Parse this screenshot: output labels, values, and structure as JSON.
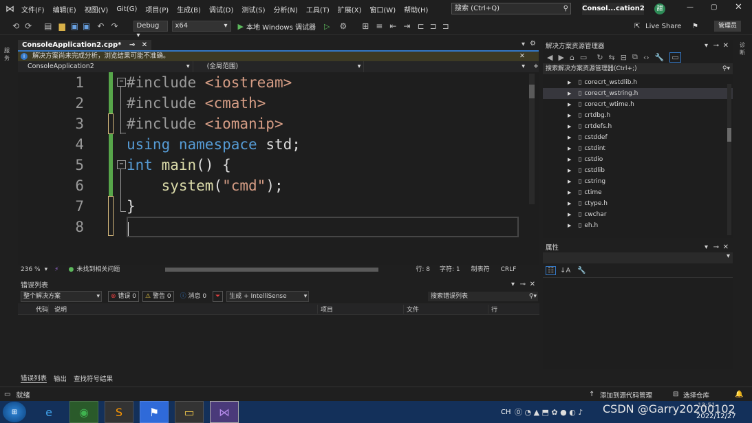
{
  "menu": [
    "文件(F)",
    "编辑(E)",
    "视图(V)",
    "Git(G)",
    "项目(P)",
    "生成(B)",
    "调试(D)",
    "测试(S)",
    "分析(N)",
    "工具(T)",
    "扩展(X)",
    "窗口(W)",
    "帮助(H)"
  ],
  "search": {
    "placeholder": "搜索 (Ctrl+Q)"
  },
  "solution_name": "Consol...cation2",
  "user_initial": "甜",
  "toolbar": {
    "config": "Debug",
    "platform": "x64",
    "debugger": "本地 Windows 调试器",
    "live_share": "Live Share",
    "admin": "管理员"
  },
  "editor": {
    "tab_label": "ConsoleApplication2.cpp*",
    "info": "解决方案尚未完成分析，浏览结果可能不准确。",
    "nav_project": "ConsoleApplication2",
    "nav_scope": "(全局范围)",
    "zoom": "236 %",
    "problems": "未找到相关问题",
    "row": "行: 8",
    "col": "字符: 1",
    "tabs_mode": "制表符",
    "eol": "CRLF",
    "lines": [
      "1",
      "2",
      "3",
      "4",
      "5",
      "6",
      "7",
      "8"
    ]
  },
  "code": [
    {
      "t1": "#include ",
      "t2": "<iostream>"
    },
    {
      "t1": "#include ",
      "t2": "<cmath>"
    },
    {
      "t1": "#include ",
      "t2": "<iomanip>"
    },
    {
      "kw1": "using",
      "kw2": "namespace",
      "id": "std;"
    },
    {
      "kw": "int",
      "fn": "main",
      "rest": "() {"
    },
    {
      "fn": "system",
      "p1": "(",
      "str": "\"cmd\"",
      "p2": ");"
    },
    {
      "brace": "}"
    }
  ],
  "error_list": {
    "title": "错误列表",
    "scope": "整个解决方案",
    "errors": "错误 0",
    "warnings": "警告 0",
    "messages": "消息 0",
    "build": "生成 + IntelliSense",
    "search_placeholder": "搜索错误列表",
    "columns": [
      "代码",
      "说明",
      "项目",
      "文件",
      "行"
    ],
    "bottom_tabs": [
      "错误列表",
      "输出",
      "查找符号结果"
    ]
  },
  "solution_explorer": {
    "title": "解决方案资源管理器",
    "search_placeholder": "搜索解决方案资源管理器(Ctrl+;)",
    "items": [
      "corecrt_wstdlib.h",
      "corecrt_wstring.h",
      "corecrt_wtime.h",
      "crtdbg.h",
      "crtdefs.h",
      "cstddef",
      "cstdint",
      "cstdio",
      "cstdlib",
      "cstring",
      "ctime",
      "ctype.h",
      "cwchar",
      "eh.h"
    ]
  },
  "properties": {
    "title": "属性"
  },
  "status": {
    "ready": "就绪",
    "add_source": "添加到源代码管理",
    "select_repo": "选择仓库"
  },
  "taskbar": {
    "ime": "CH",
    "watermark": "CSDN @Garry20200102",
    "time": "13:51",
    "date": "2022/12/27"
  },
  "colors": {
    "accent": "#3478c6",
    "vs_purple": "#8661c5",
    "modified_green": "#57a64a",
    "unsaved_yellow": "#d7ba7d"
  }
}
